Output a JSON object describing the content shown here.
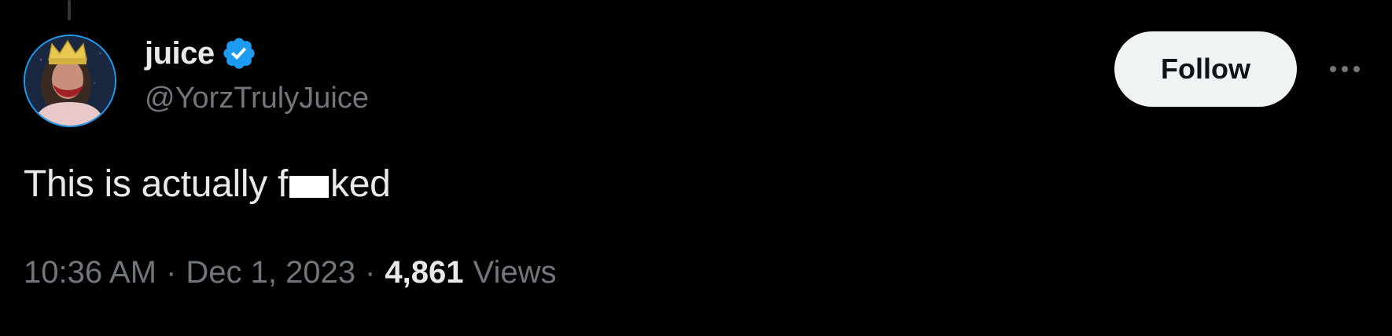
{
  "tweet": {
    "author": {
      "display_name": "juice",
      "handle": "@YorzTrulyJuice",
      "verified": true,
      "verified_icon": "verified-badge-icon",
      "avatar_icon": "avatar-image"
    },
    "follow_label": "Follow",
    "more_icon": "more-options-icon",
    "text_prefix": "This is actually f",
    "text_suffix": "ked",
    "time": "10:36 AM",
    "separator": "·",
    "date": "Dec 1, 2023",
    "views_count": "4,861",
    "views_label": "Views"
  },
  "colors": {
    "background": "#000000",
    "primary_text": "#e7e9ea",
    "secondary_text": "#71767b",
    "verified_blue": "#1d9bf0",
    "follow_button_bg": "#eff3f4",
    "follow_button_text": "#0f1419"
  }
}
